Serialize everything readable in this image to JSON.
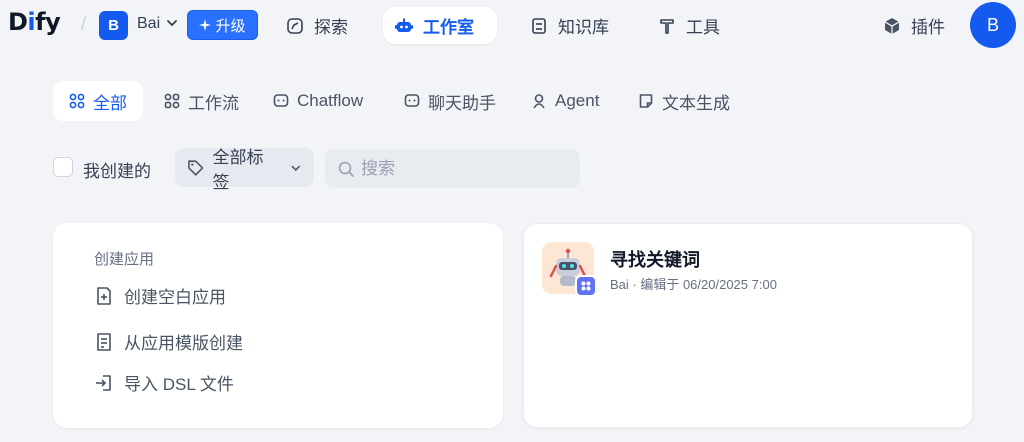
{
  "header": {
    "logo_main": "D",
    "logo_dot": "i",
    "logo_rest": "fy",
    "workspace_initial": "B",
    "workspace_name": "Bai",
    "upgrade_label": "升级",
    "nav": {
      "explore": "探索",
      "studio": "工作室",
      "knowledge": "知识库",
      "tools": "工具",
      "plugins": "插件"
    },
    "user_initial": "B"
  },
  "tabs": [
    {
      "label": "全部",
      "active": true
    },
    {
      "label": "工作流"
    },
    {
      "label": "Chatflow"
    },
    {
      "label": "聊天助手"
    },
    {
      "label": "Agent"
    },
    {
      "label": "文本生成"
    }
  ],
  "filters": {
    "created_by_me": "我创建的",
    "tags_label": "全部标签",
    "search_placeholder": "搜索"
  },
  "create_card": {
    "title": "创建应用",
    "items": [
      "创建空白应用",
      "从应用模版创建",
      "导入 DSL 文件"
    ]
  },
  "apps": [
    {
      "name": "寻找关键词",
      "meta": "Bai · 编辑于 06/20/2025 7:00"
    }
  ],
  "colors": {
    "accent": "#155aef",
    "background": "#f2f4f7"
  }
}
